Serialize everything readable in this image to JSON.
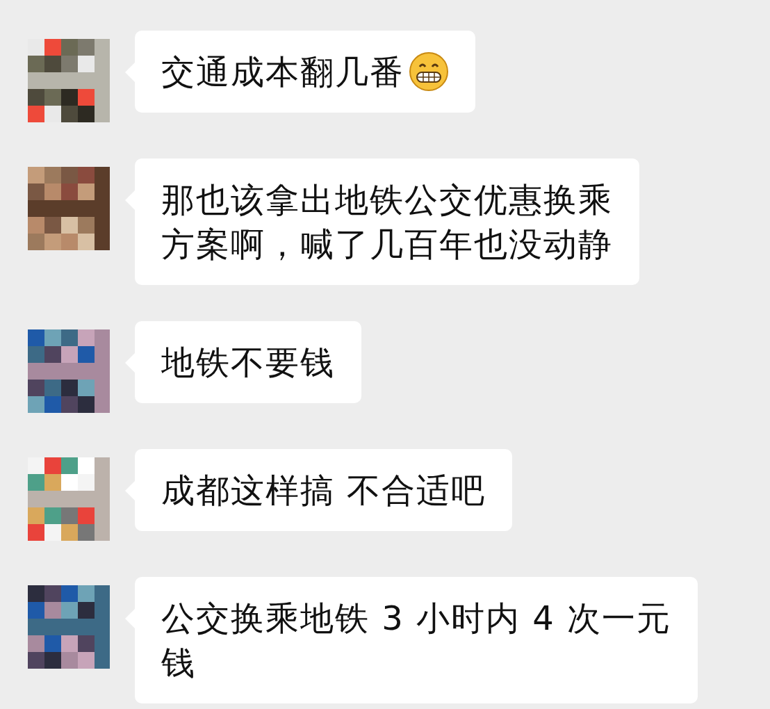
{
  "messages": [
    {
      "lines": [
        "交通成本翻几番"
      ],
      "has_emoji": true
    },
    {
      "lines": [
        "那也该拿出地铁公交优惠换乘",
        "方案啊，喊了几百年也没动静"
      ]
    },
    {
      "lines": [
        "地铁不要钱"
      ]
    },
    {
      "lines": [
        "成都这样搞 不合适吧"
      ]
    },
    {
      "lines": [
        "公交换乘地铁 3 小时内 4 次一元",
        "钱"
      ]
    }
  ]
}
